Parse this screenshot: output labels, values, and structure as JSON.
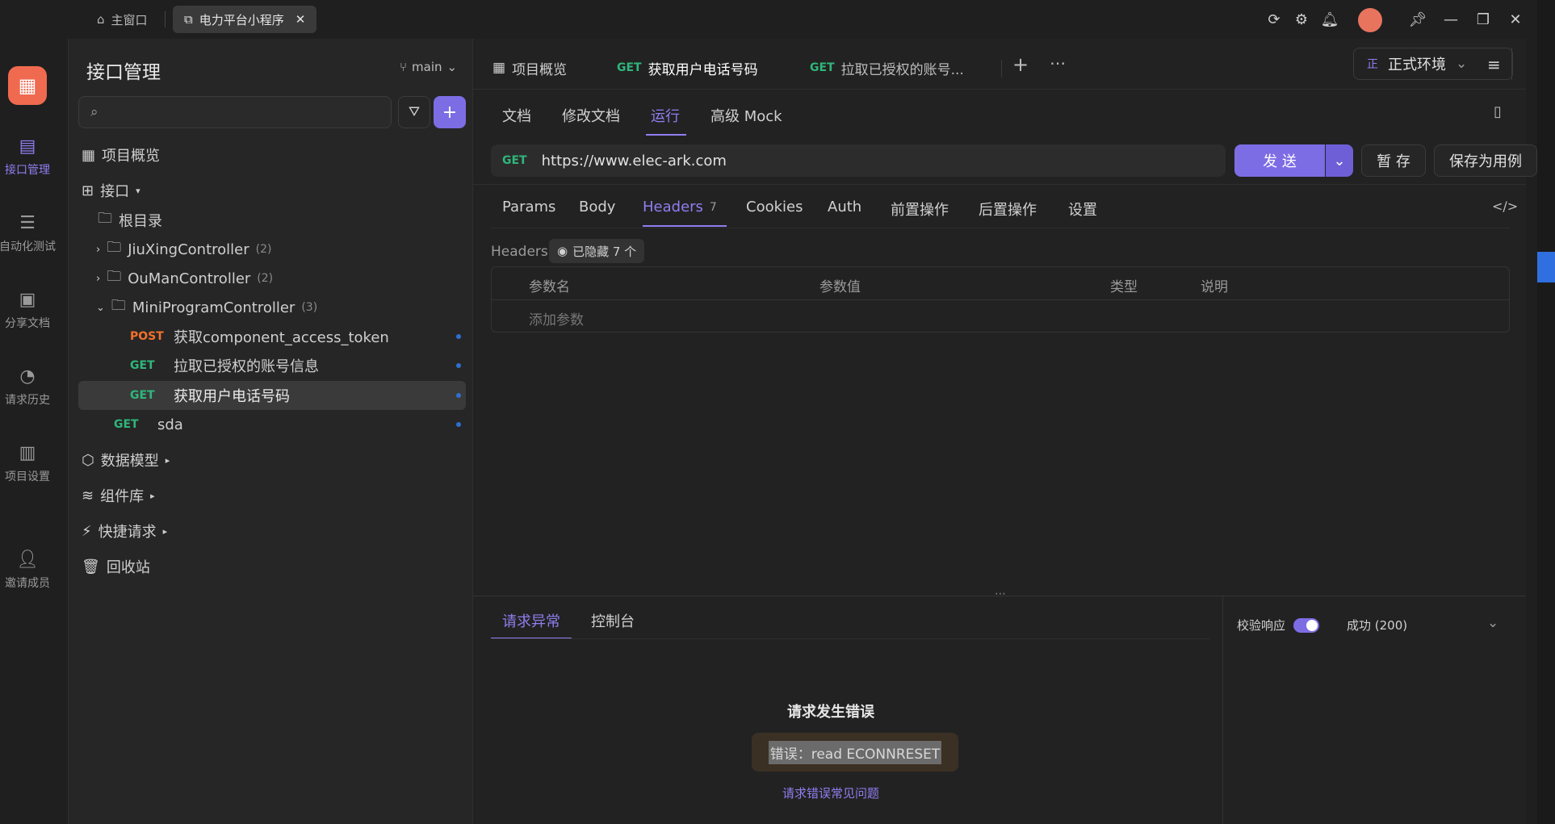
{
  "titlebar": {
    "home_tab": "主窗口",
    "active_tab": "电力平台小程序"
  },
  "rail": {
    "items": [
      {
        "label": "接口管理",
        "icon": "api-icon"
      },
      {
        "label": "自动化测试",
        "icon": "automation-icon"
      },
      {
        "label": "分享文档",
        "icon": "share-doc-icon"
      },
      {
        "label": "请求历史",
        "icon": "history-icon"
      },
      {
        "label": "项目设置",
        "icon": "settings-icon"
      },
      {
        "label": "邀请成员",
        "icon": "invite-icon"
      }
    ]
  },
  "sidebar": {
    "title": "接口管理",
    "branch": "main",
    "search_placeholder": "",
    "overview": "项目概览",
    "interfaces": "接口",
    "root": "根目录",
    "folders": [
      {
        "name": "JiuXingController",
        "count": "(2)"
      },
      {
        "name": "OuManController",
        "count": "(2)"
      },
      {
        "name": "MiniProgramController",
        "count": "(3)"
      }
    ],
    "endpoints": [
      {
        "method": "POST",
        "name": "获取component_access_token"
      },
      {
        "method": "GET",
        "name": "拉取已授权的账号信息"
      },
      {
        "method": "GET",
        "name": "获取用户电话号码"
      }
    ],
    "root_endpoint": {
      "method": "GET",
      "name": "sda"
    },
    "data_model": "数据模型",
    "components": "组件库",
    "quick_request": "快捷请求",
    "recycle": "回收站"
  },
  "main": {
    "tabs": [
      {
        "label": "项目概览"
      },
      {
        "method": "GET",
        "label": "获取用户电话号码"
      },
      {
        "method": "GET",
        "label": "拉取已授权的账号..."
      }
    ],
    "env": {
      "badge": "正",
      "label": "正式环境"
    },
    "subtabs": [
      "文档",
      "修改文档",
      "运行",
      "高级 Mock"
    ],
    "request": {
      "method": "GET",
      "url": "https://www.elec-ark.com",
      "send": "发 送",
      "save_temp": "暂 存",
      "save_case": "保存为用例"
    },
    "param_tabs": [
      "Params",
      "Body",
      "Headers",
      "Cookies",
      "Auth",
      "前置操作",
      "后置操作",
      "设置"
    ],
    "headers_count": "7",
    "headers_label": "Headers",
    "hidden_badge": "已隐藏 7 个",
    "table_headers": [
      "参数名",
      "参数值",
      "类型",
      "说明"
    ],
    "add_param": "添加参数"
  },
  "response": {
    "tabs": [
      "请求异常",
      "控制台"
    ],
    "validate_label": "校验响应",
    "status": "成功 (200)",
    "error_title": "请求发生错误",
    "error_msg": "错误：read ECONNRESET",
    "error_link": "请求错误常见问题"
  }
}
